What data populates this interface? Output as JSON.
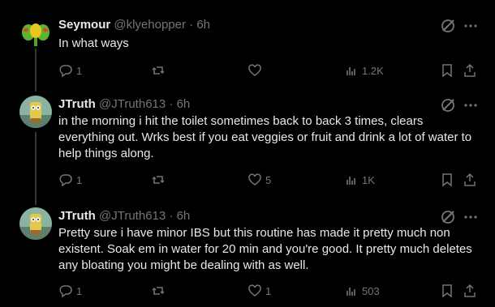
{
  "posts": [
    {
      "author_name": "Seymour",
      "handle": "@klyehopper",
      "time_sep": "·",
      "time": "6h",
      "text": "In what ways",
      "replies": "1",
      "reposts": "",
      "likes": "",
      "views": "1.2K"
    },
    {
      "author_name": "JTruth",
      "handle": "@JTruth613",
      "time_sep": "·",
      "time": "6h",
      "text": "in the morning i hit the toilet sometimes back to back 3 times, clears everything out. Wrks best if you eat veggies or fruit and drink a lot of water to help things along.",
      "replies": "1",
      "reposts": "",
      "likes": "5",
      "views": "1K"
    },
    {
      "author_name": "JTruth",
      "handle": "@JTruth613",
      "time_sep": "·",
      "time": "6h",
      "text": "Pretty sure i have minor IBS but this routine has made it pretty much non existent. Soak em in water for 20 min and you're good. It pretty much deletes any bloating you might be dealing with as well.",
      "replies": "1",
      "reposts": "",
      "likes": "1",
      "views": "503"
    }
  ],
  "icons": {
    "reply": "speech-bubble-icon",
    "repost": "repost-arrows-icon",
    "like": "heart-icon",
    "views": "bar-chart-icon",
    "bookmark": "bookmark-icon",
    "share": "share-upload-icon",
    "grok": "grok-slash-icon",
    "more": "more-dots-icon"
  },
  "colors": {
    "background": "#000000",
    "text": "#e7e9ea",
    "muted": "#71767b",
    "thread_line": "#333639"
  }
}
